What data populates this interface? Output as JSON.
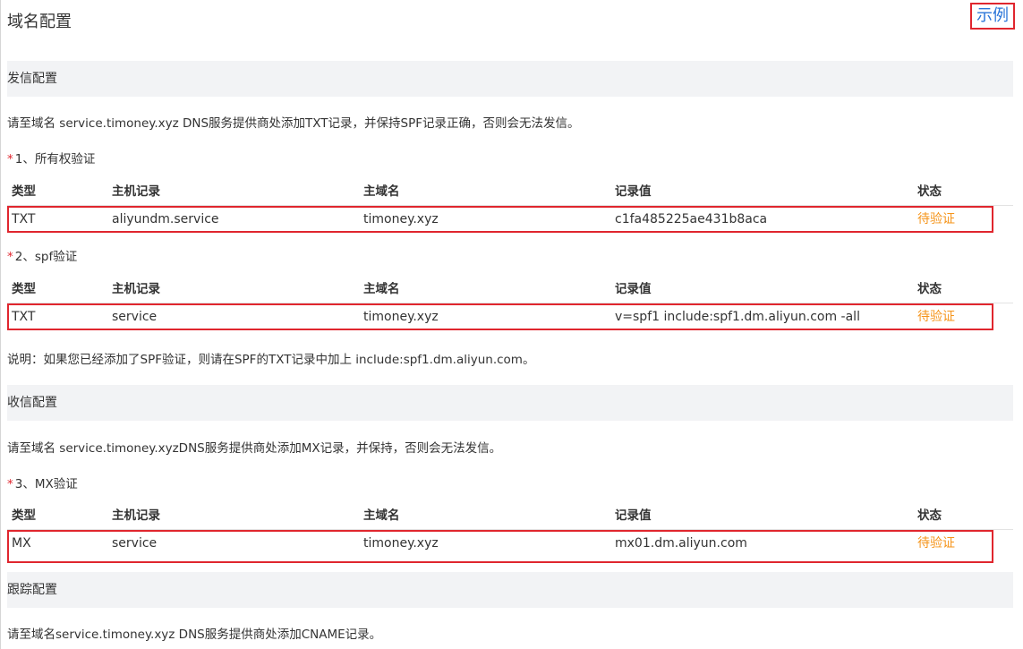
{
  "page": {
    "title": "域名配置",
    "example_link": "示例"
  },
  "send_config": {
    "title": "发信配置",
    "desc": "请至域名 service.timoney.xyz DNS服务提供商处添加TXT记录，并保持SPF记录正确，否则会无法发信。",
    "step1": {
      "mark": "*",
      "label": "1、所有权验证"
    },
    "step2": {
      "mark": "*",
      "label": "2、spf验证"
    },
    "note": "说明：如果您已经添加了SPF验证，则请在SPF的TXT记录中加上 include:spf1.dm.aliyun.com。"
  },
  "receive_config": {
    "title": "收信配置",
    "desc": "请至域名 service.timoney.xyzDNS服务提供商处添加MX记录，并保持，否则会无法发信。",
    "step3": {
      "mark": "*",
      "label": "3、MX验证"
    }
  },
  "tracking_config": {
    "title": "跟踪配置",
    "desc": "请至域名service.timoney.xyz DNS服务提供商处添加CNAME记录。"
  },
  "table_headers": {
    "type": "类型",
    "host": "主机记录",
    "domain": "主域名",
    "value": "记录值",
    "status": "状态"
  },
  "records": {
    "ownership": {
      "type": "TXT",
      "host": "aliyundm.service",
      "domain": "timoney.xyz",
      "value": "c1fa485225ae431b8aca",
      "status": "待验证"
    },
    "spf": {
      "type": "TXT",
      "host": "service",
      "domain": "timoney.xyz",
      "value": "v=spf1 include:spf1.dm.aliyun.com -all",
      "status": "待验证"
    },
    "mx": {
      "type": "MX",
      "host": "service",
      "domain": "timoney.xyz",
      "value": "mx01.dm.aliyun.com",
      "status": "待验证"
    }
  },
  "colors": {
    "status_pending": "#f5941a",
    "link": "#2a75d8",
    "highlight_border": "#e0262e",
    "section_bg": "#f2f3f5"
  }
}
